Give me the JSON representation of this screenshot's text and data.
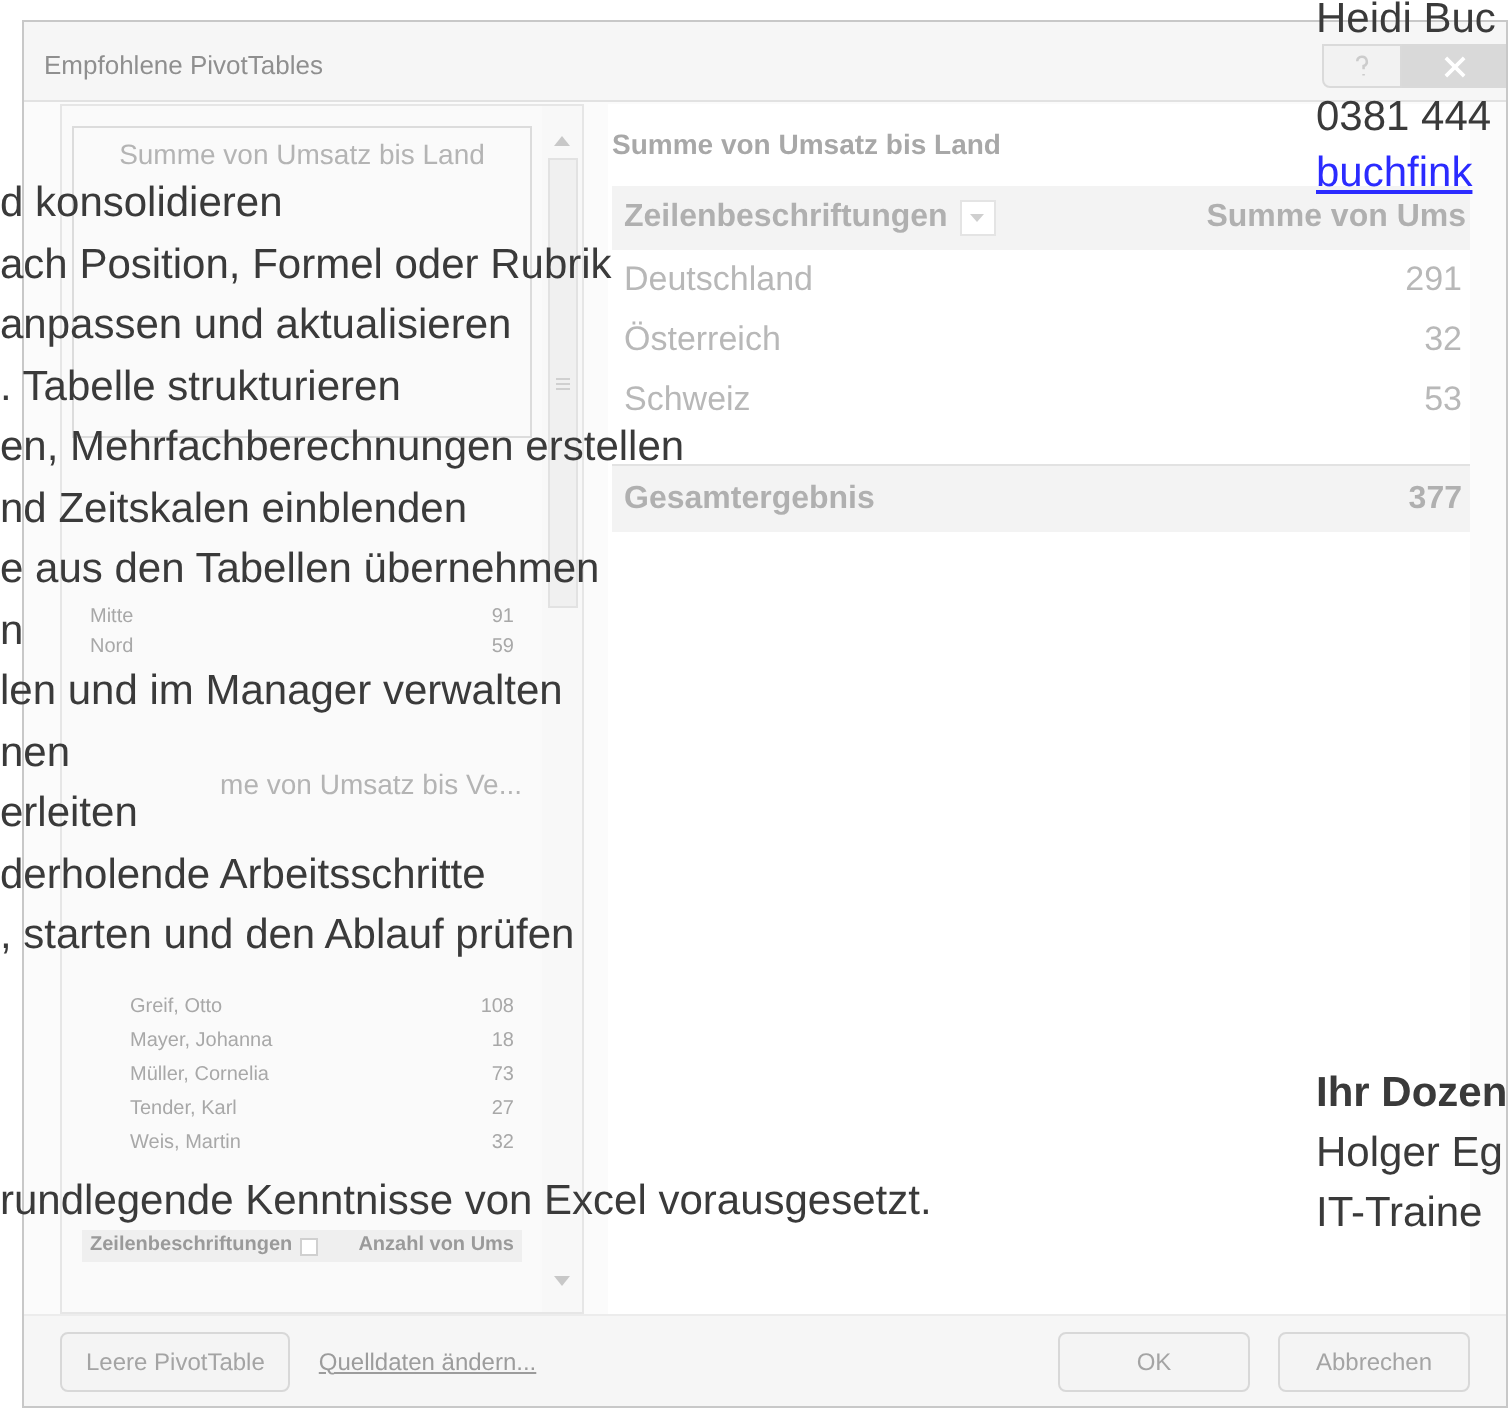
{
  "dialog": {
    "title": "Empfohlene PivotTables",
    "recommendations": [
      {
        "title": "Summe von Umsatz bis Land",
        "selected": true,
        "rows": [
          {
            "kind": "header"
          },
          {
            "kind": "item"
          },
          {
            "kind": "item"
          },
          {
            "kind": "item"
          },
          {
            "kind": "total"
          }
        ]
      },
      {
        "selected": false,
        "rows": [
          {
            "kind": "header"
          },
          {
            "kind": "item",
            "label": "Mitte",
            "value": "91"
          },
          {
            "kind": "item",
            "label": "Nord",
            "value": "59"
          },
          {
            "kind": "item"
          },
          {
            "kind": "total"
          }
        ]
      },
      {
        "title": "me von Umsatz bis Ve...",
        "selected": false,
        "rows": [
          {
            "kind": "header"
          },
          {
            "kind": "group"
          },
          {
            "kind": "child"
          },
          {
            "kind": "child",
            "label": "Greif, Otto",
            "value": "108"
          },
          {
            "kind": "child",
            "label": "Mayer, Johanna",
            "value": "18"
          },
          {
            "kind": "child",
            "label": "Müller, Cornelia",
            "value": "73"
          },
          {
            "kind": "child",
            "label": "Tender, Karl",
            "value": "27"
          },
          {
            "kind": "child",
            "label": "Weis, Martin",
            "value": "32"
          },
          {
            "kind": "child"
          }
        ]
      },
      {
        "selected": false,
        "rows": [
          {
            "kind": "header",
            "label": "Zeilenbeschriftungen",
            "value": "Anzahl von Ums"
          }
        ]
      }
    ],
    "preview": {
      "title": "Summe von Umsatz bis Land",
      "columns": [
        "Zeilenbeschriftungen",
        "Summe von Ums"
      ],
      "rows": [
        {
          "kind": "item",
          "label": "Deutschland",
          "value": "291"
        },
        {
          "kind": "item",
          "label": "Österreich",
          "value": "32"
        },
        {
          "kind": "item",
          "label": "Schweiz",
          "value": "53"
        },
        {
          "kind": "total",
          "label": "Gesamtergebnis",
          "value": "377"
        }
      ]
    },
    "buttons": [
      {
        "kind": "button",
        "label": "Leere PivotTable"
      },
      {
        "kind": "link",
        "label": "Quelldaten ändern..."
      },
      {
        "kind": "spacer"
      },
      {
        "kind": "button",
        "label": "OK"
      },
      {
        "kind": "button",
        "label": "Abbrechen"
      }
    ]
  },
  "document": {
    "lines": [
      "d konsolidieren",
      "ach Position, Formel oder Rubrik",
      "anpassen und aktualisieren",
      ". Tabelle strukturieren",
      "en, Mehrfachberechnungen erstellen",
      "nd Zeitskalen einblenden",
      "e aus den Tabellen übernehmen",
      "n",
      "len und im Manager verwalten",
      "nen",
      "erleiten",
      "derholende Arbeitsschritte",
      ", starten und den Ablauf prüfen"
    ],
    "note": "rundlegende Kenntnisse von Excel vorausgesetzt.",
    "contact": {
      "name": "Heidi Buc",
      "phone": "0381 444",
      "email": "buchfink"
    },
    "lecturer": {
      "heading": "Ihr Dozen",
      "name": "Holger Eg",
      "role": "IT-Traine"
    }
  }
}
